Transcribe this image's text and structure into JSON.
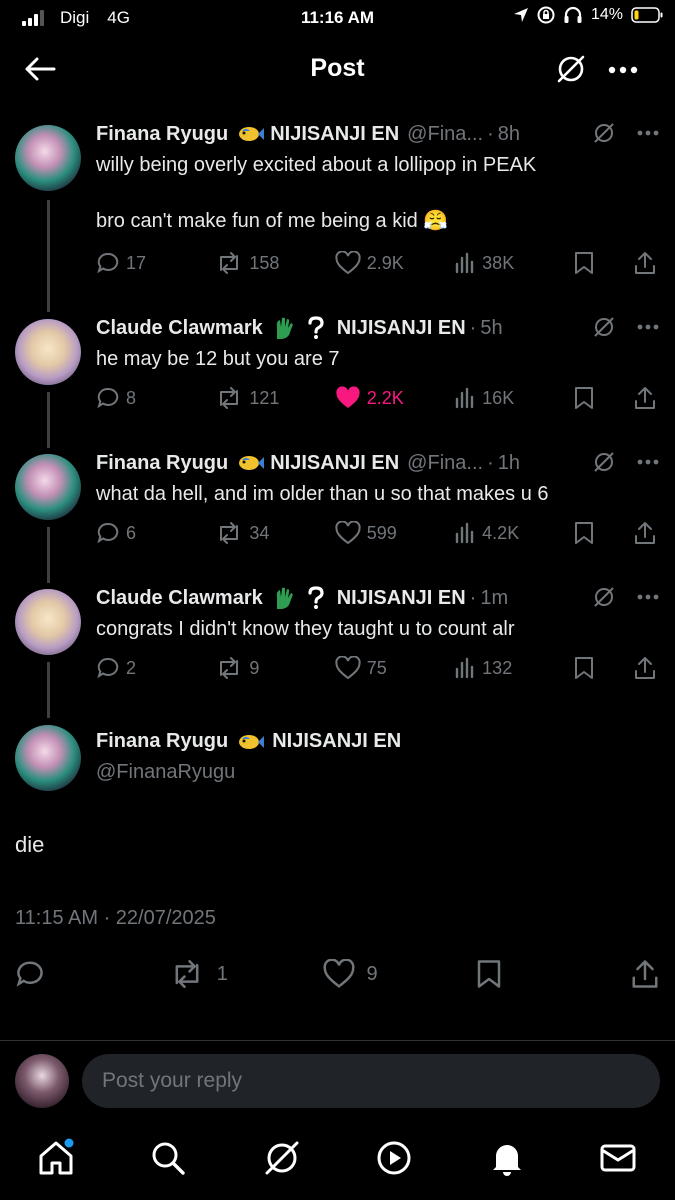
{
  "status_bar": {
    "carrier": "Digi",
    "network": "4G",
    "time": "11:16 AM",
    "battery": "14%"
  },
  "header": {
    "title": "Post"
  },
  "thread": [
    {
      "author": "Finana Ryugu",
      "org": "NIJISANJI EN",
      "handle": "@Fina...",
      "time": "8h",
      "text": "willy being overly excited about a lollipop in PEAK\n\nbro can't make fun of me being a kid 😤",
      "replies": "17",
      "reposts": "158",
      "likes": "2.9K",
      "views": "38K",
      "liked": false
    },
    {
      "author": "Claude Clawmark",
      "org": "NIJISANJI EN",
      "handle": "",
      "time": "5h",
      "text": "he may be 12 but you are 7",
      "replies": "8",
      "reposts": "121",
      "likes": "2.2K",
      "views": "16K",
      "liked": true
    },
    {
      "author": "Finana Ryugu",
      "org": "NIJISANJI EN",
      "handle": "@Fina...",
      "time": "1h",
      "text": "what da hell, and im older than u so that makes u 6",
      "replies": "6",
      "reposts": "34",
      "likes": "599",
      "views": "4.2K",
      "liked": false
    },
    {
      "author": "Claude Clawmark",
      "org": "NIJISANJI EN",
      "handle": "",
      "time": "1m",
      "text": "congrats I didn't know they taught u to count alr",
      "replies": "2",
      "reposts": "9",
      "likes": "75",
      "views": "132",
      "liked": false
    }
  ],
  "main_post": {
    "author": "Finana Ryugu",
    "org": "NIJISANJI EN",
    "handle": "@FinanaRyugu",
    "text": "die",
    "timestamp": "11:15 AM · 22/07/2025",
    "reposts": "1",
    "likes": "9"
  },
  "reply_bar": {
    "placeholder": "Post your reply"
  },
  "colors": {
    "background": "#000000",
    "text": "#e7e9ea",
    "muted": "#71767b",
    "like": "#f91880",
    "notification_dot": "#1d9bf0"
  },
  "icons": {
    "finana_badge": "fish-icon",
    "claude_badge": "claw-icon",
    "claude_badge_2": "question-icon"
  }
}
